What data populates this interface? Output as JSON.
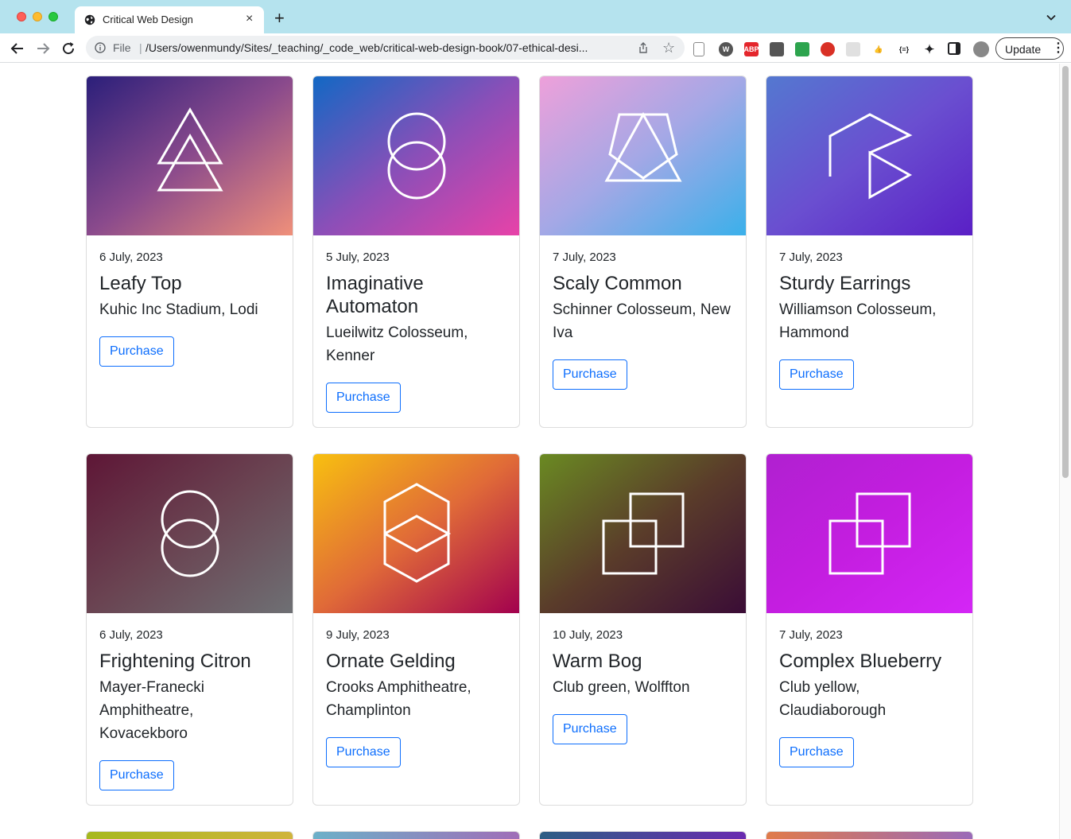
{
  "browser": {
    "tab_title": "Critical Web Design",
    "tab_close": "×",
    "new_tab": "+",
    "scheme": "File",
    "separator": "|",
    "url": "/Users/owenmundy/Sites/_teaching/_code_web/critical-web-design-book/07-ethical-desi...",
    "update_label": "Update",
    "kebab": "⋮",
    "extensions": [
      {
        "name": "page-icon",
        "label": "",
        "color": "#e8e8e8"
      },
      {
        "name": "wordpress-icon",
        "label": "W",
        "color": "#555555"
      },
      {
        "name": "adblock-icon",
        "label": "ABP",
        "color": "#e4262c"
      },
      {
        "name": "archive-icon",
        "label": "",
        "color": "#555555"
      },
      {
        "name": "green-ext-icon",
        "label": "",
        "color": "#2da44e"
      },
      {
        "name": "blocked-ext-icon",
        "label": "",
        "color": "#d93025"
      },
      {
        "name": "grid-ext-icon",
        "label": "",
        "color": "#e0e0e0"
      },
      {
        "name": "thumbs-up-icon",
        "label": "👍",
        "color": "#ffffff"
      },
      {
        "name": "json-ext-icon",
        "label": "{≡}",
        "color": "#ffffff"
      },
      {
        "name": "puzzle-icon",
        "label": "",
        "color": "#ffffff"
      },
      {
        "name": "sidepanel-icon",
        "label": "",
        "color": "#ffffff"
      },
      {
        "name": "avatar",
        "label": "",
        "color": "#888888"
      }
    ]
  },
  "cards": [
    {
      "date": "6 July, 2023",
      "title": "Leafy Top",
      "venue": "Kuhic Inc Stadium, Lodi",
      "button": "Purchase",
      "icon": "triangles-icon",
      "grad": [
        "#2b1f7a",
        "#8a4a8c",
        "#f0907a"
      ]
    },
    {
      "date": "5 July, 2023",
      "title": "Imaginative Automaton",
      "venue": "Lueilwitz Colosseum, Kenner",
      "button": "Purchase",
      "icon": "stacked-circles-icon",
      "grad": [
        "#1268c4",
        "#8a4fb8",
        "#e842a8"
      ]
    },
    {
      "date": "7 July, 2023",
      "title": "Scaly Common",
      "venue": "Schinner Colosseum, New Iva",
      "button": "Purchase",
      "icon": "pentagon-triangle-icon",
      "grad": [
        "#eea0da",
        "#a3a8e6",
        "#3ab0ea"
      ]
    },
    {
      "date": "7 July, 2023",
      "title": "Sturdy Earrings",
      "venue": "Williamson Colosseum, Hammond",
      "button": "Purchase",
      "icon": "play-shape-icon",
      "grad": [
        "#5478d0",
        "#6a4fd0",
        "#5a1fc6"
      ]
    },
    {
      "date": "6 July, 2023",
      "title": "Frightening Citron",
      "venue": "Mayer-Franecki Amphitheatre, Kovacekboro",
      "button": "Purchase",
      "icon": "stacked-circles-icon",
      "grad": [
        "#5e1636",
        "#6a4452",
        "#6e7074"
      ]
    },
    {
      "date": "9 July, 2023",
      "title": "Ornate Gelding",
      "venue": "Crooks Amphitheatre, Champlinton",
      "button": "Purchase",
      "icon": "hexagon-icon",
      "grad": [
        "#f8c010",
        "#e06a38",
        "#a2004e"
      ]
    },
    {
      "date": "10 July, 2023",
      "title": "Warm Bog",
      "venue": "Club green, Wolffton",
      "button": "Purchase",
      "icon": "overlapping-squares-icon",
      "grad": [
        "#6a8a22",
        "#5a3c2a",
        "#3a0c36"
      ]
    },
    {
      "date": "7 July, 2023",
      "title": "Complex Blueberry",
      "venue": "Club yellow, Claudiaborough",
      "button": "Purchase",
      "icon": "overlapping-squares-icon",
      "grad": [
        "#b020d0",
        "#c41ee0",
        "#d426f6"
      ]
    }
  ],
  "next_row_colors": [
    [
      "#a6b81e",
      "#d0b43c"
    ],
    [
      "#6cb0c8",
      "#a06eb8"
    ],
    [
      "#2c5e84",
      "#6a2ab0"
    ],
    [
      "#e07a4a",
      "#9a6ab8"
    ]
  ]
}
